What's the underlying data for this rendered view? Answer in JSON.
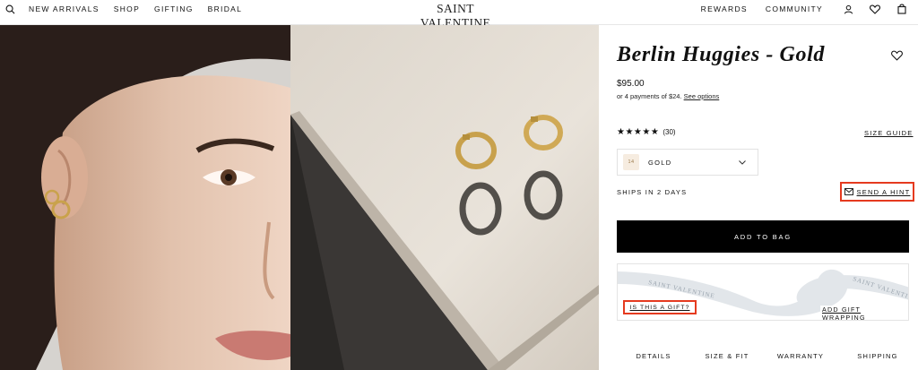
{
  "header": {
    "nav_left": [
      "NEW ARRIVALS",
      "SHOP",
      "GIFTING",
      "BRIDAL"
    ],
    "brand": "SAINT VALENTINE",
    "nav_right": [
      "REWARDS",
      "COMMUNITY"
    ],
    "icons": [
      "search-icon",
      "account-icon",
      "wishlist-icon",
      "bag-icon"
    ]
  },
  "product": {
    "title": "Berlin Huggies - Gold",
    "price": "$95.00",
    "installments_prefix": "or 4 payments of $24.",
    "see_options": "See options",
    "stars": "★★★★★",
    "review_count": "(30)",
    "rating_value": 5,
    "size_guide": "SIZE GUIDE",
    "variant_swatch_label": "14",
    "variant_selected": "GOLD",
    "ships": "SHIPS IN 2 DAYS",
    "send_hint": "SEND A HINT",
    "add_to_bag": "ADD TO BAG",
    "gift_question": "IS THIS A GIFT?",
    "add_gift_wrapping": "ADD GIFT WRAPPING",
    "ribbon_text": "SAINT VALENTINE"
  },
  "tabs": [
    "DETAILS",
    "SIZE & FIT",
    "WARRANTY",
    "SHIPPING"
  ],
  "colors": {
    "accent_highlight": "#e53a1f",
    "primary_button": "#000000",
    "text": "#111111"
  }
}
